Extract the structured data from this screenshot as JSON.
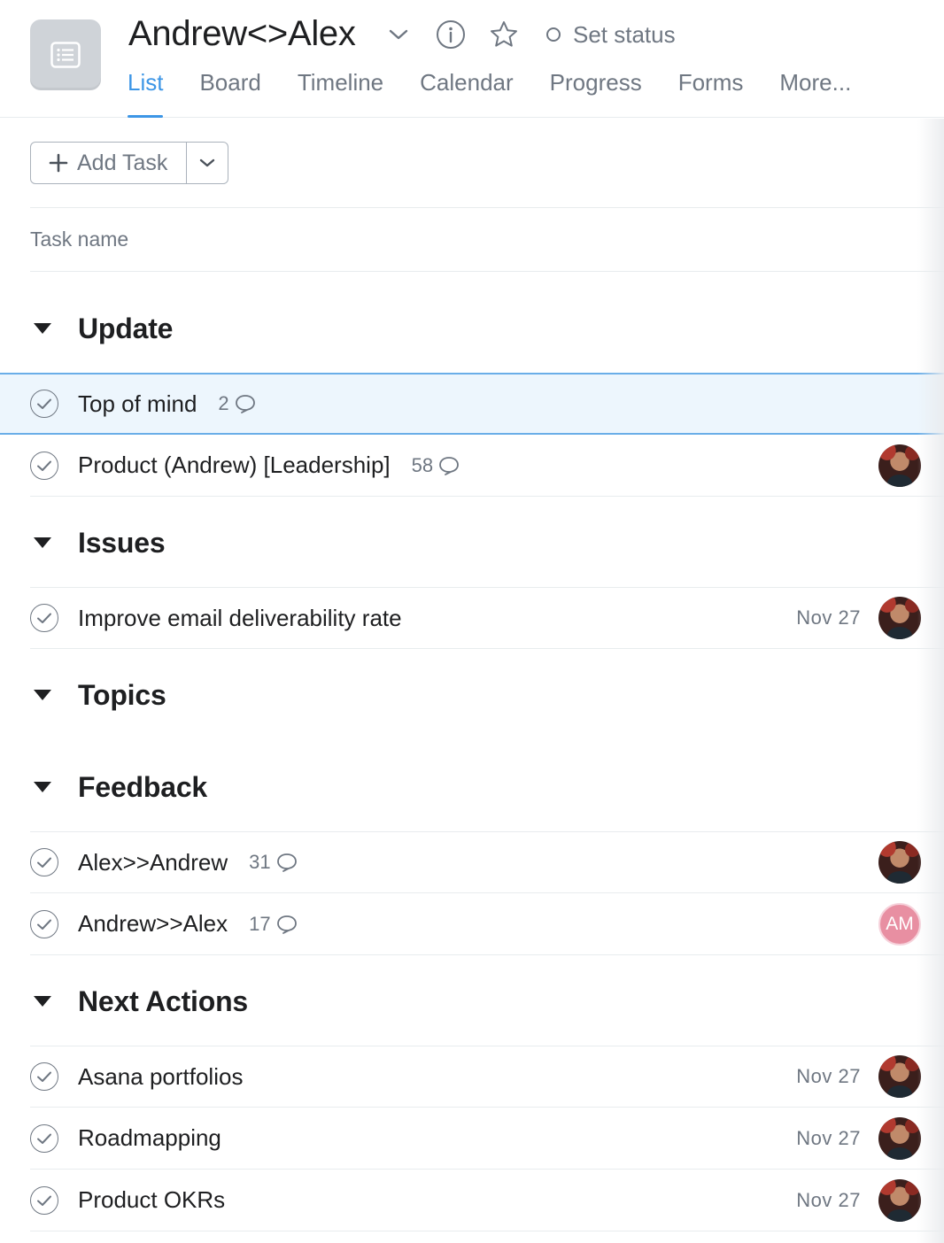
{
  "header": {
    "project_title": "Andrew<>Alex",
    "set_status_label": "Set status",
    "project_icon": "list-icon",
    "tabs": [
      {
        "label": "List",
        "active": true
      },
      {
        "label": "Board"
      },
      {
        "label": "Timeline"
      },
      {
        "label": "Calendar"
      },
      {
        "label": "Progress"
      },
      {
        "label": "Forms"
      },
      {
        "label": "More..."
      }
    ]
  },
  "toolbar": {
    "add_task_label": "Add Task"
  },
  "columns": {
    "task_name": "Task name"
  },
  "sections": [
    {
      "title": "Update",
      "tasks": [
        {
          "name": "Top of mind",
          "comments": "2",
          "due": "",
          "assignee": "",
          "selected": true
        },
        {
          "name": "Product (Andrew) [Leadership]",
          "comments": "58",
          "due": "",
          "assignee": "photo"
        }
      ]
    },
    {
      "title": "Issues",
      "tasks": [
        {
          "name": "Improve email deliverability rate",
          "comments": "",
          "due": "Nov 27",
          "assignee": "photo"
        }
      ]
    },
    {
      "title": "Topics",
      "tasks": []
    },
    {
      "title": "Feedback",
      "tasks": [
        {
          "name": "Alex>>Andrew",
          "comments": "31",
          "due": "",
          "assignee": "photo"
        },
        {
          "name": "Andrew>>Alex",
          "comments": "17",
          "due": "",
          "assignee": "AM"
        }
      ]
    },
    {
      "title": "Next Actions",
      "tasks": [
        {
          "name": "Asana portfolios",
          "comments": "",
          "due": "Nov 27",
          "assignee": "photo"
        },
        {
          "name": "Roadmapping",
          "comments": "",
          "due": "Nov 27",
          "assignee": "photo"
        },
        {
          "name": "Product OKRs",
          "comments": "",
          "due": "Nov 27",
          "assignee": "photo"
        }
      ]
    }
  ],
  "colors": {
    "accent": "#3d96e6",
    "selected_row_bg": "#edf6fd",
    "muted_text": "#6f7782",
    "avatar_initials_bg": "#e88fa2"
  }
}
